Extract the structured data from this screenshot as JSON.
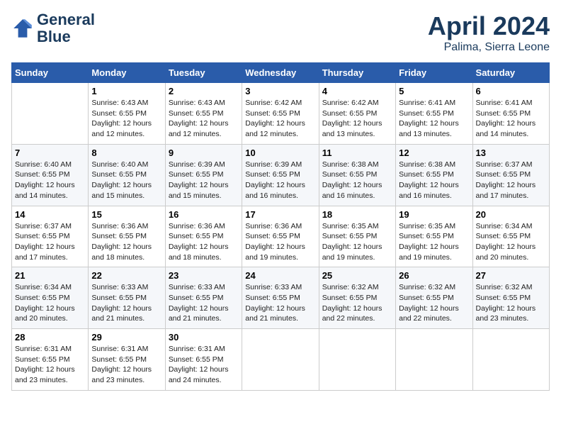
{
  "header": {
    "logo_line1": "General",
    "logo_line2": "Blue",
    "month": "April 2024",
    "location": "Palima, Sierra Leone"
  },
  "columns": [
    "Sunday",
    "Monday",
    "Tuesday",
    "Wednesday",
    "Thursday",
    "Friday",
    "Saturday"
  ],
  "weeks": [
    [
      {
        "day": "",
        "info": ""
      },
      {
        "day": "1",
        "info": "Sunrise: 6:43 AM\nSunset: 6:55 PM\nDaylight: 12 hours\nand 12 minutes."
      },
      {
        "day": "2",
        "info": "Sunrise: 6:43 AM\nSunset: 6:55 PM\nDaylight: 12 hours\nand 12 minutes."
      },
      {
        "day": "3",
        "info": "Sunrise: 6:42 AM\nSunset: 6:55 PM\nDaylight: 12 hours\nand 12 minutes."
      },
      {
        "day": "4",
        "info": "Sunrise: 6:42 AM\nSunset: 6:55 PM\nDaylight: 12 hours\nand 13 minutes."
      },
      {
        "day": "5",
        "info": "Sunrise: 6:41 AM\nSunset: 6:55 PM\nDaylight: 12 hours\nand 13 minutes."
      },
      {
        "day": "6",
        "info": "Sunrise: 6:41 AM\nSunset: 6:55 PM\nDaylight: 12 hours\nand 14 minutes."
      }
    ],
    [
      {
        "day": "7",
        "info": "Sunrise: 6:40 AM\nSunset: 6:55 PM\nDaylight: 12 hours\nand 14 minutes."
      },
      {
        "day": "8",
        "info": "Sunrise: 6:40 AM\nSunset: 6:55 PM\nDaylight: 12 hours\nand 15 minutes."
      },
      {
        "day": "9",
        "info": "Sunrise: 6:39 AM\nSunset: 6:55 PM\nDaylight: 12 hours\nand 15 minutes."
      },
      {
        "day": "10",
        "info": "Sunrise: 6:39 AM\nSunset: 6:55 PM\nDaylight: 12 hours\nand 16 minutes."
      },
      {
        "day": "11",
        "info": "Sunrise: 6:38 AM\nSunset: 6:55 PM\nDaylight: 12 hours\nand 16 minutes."
      },
      {
        "day": "12",
        "info": "Sunrise: 6:38 AM\nSunset: 6:55 PM\nDaylight: 12 hours\nand 16 minutes."
      },
      {
        "day": "13",
        "info": "Sunrise: 6:37 AM\nSunset: 6:55 PM\nDaylight: 12 hours\nand 17 minutes."
      }
    ],
    [
      {
        "day": "14",
        "info": "Sunrise: 6:37 AM\nSunset: 6:55 PM\nDaylight: 12 hours\nand 17 minutes."
      },
      {
        "day": "15",
        "info": "Sunrise: 6:36 AM\nSunset: 6:55 PM\nDaylight: 12 hours\nand 18 minutes."
      },
      {
        "day": "16",
        "info": "Sunrise: 6:36 AM\nSunset: 6:55 PM\nDaylight: 12 hours\nand 18 minutes."
      },
      {
        "day": "17",
        "info": "Sunrise: 6:36 AM\nSunset: 6:55 PM\nDaylight: 12 hours\nand 19 minutes."
      },
      {
        "day": "18",
        "info": "Sunrise: 6:35 AM\nSunset: 6:55 PM\nDaylight: 12 hours\nand 19 minutes."
      },
      {
        "day": "19",
        "info": "Sunrise: 6:35 AM\nSunset: 6:55 PM\nDaylight: 12 hours\nand 19 minutes."
      },
      {
        "day": "20",
        "info": "Sunrise: 6:34 AM\nSunset: 6:55 PM\nDaylight: 12 hours\nand 20 minutes."
      }
    ],
    [
      {
        "day": "21",
        "info": "Sunrise: 6:34 AM\nSunset: 6:55 PM\nDaylight: 12 hours\nand 20 minutes."
      },
      {
        "day": "22",
        "info": "Sunrise: 6:33 AM\nSunset: 6:55 PM\nDaylight: 12 hours\nand 21 minutes."
      },
      {
        "day": "23",
        "info": "Sunrise: 6:33 AM\nSunset: 6:55 PM\nDaylight: 12 hours\nand 21 minutes."
      },
      {
        "day": "24",
        "info": "Sunrise: 6:33 AM\nSunset: 6:55 PM\nDaylight: 12 hours\nand 21 minutes."
      },
      {
        "day": "25",
        "info": "Sunrise: 6:32 AM\nSunset: 6:55 PM\nDaylight: 12 hours\nand 22 minutes."
      },
      {
        "day": "26",
        "info": "Sunrise: 6:32 AM\nSunset: 6:55 PM\nDaylight: 12 hours\nand 22 minutes."
      },
      {
        "day": "27",
        "info": "Sunrise: 6:32 AM\nSunset: 6:55 PM\nDaylight: 12 hours\nand 23 minutes."
      }
    ],
    [
      {
        "day": "28",
        "info": "Sunrise: 6:31 AM\nSunset: 6:55 PM\nDaylight: 12 hours\nand 23 minutes."
      },
      {
        "day": "29",
        "info": "Sunrise: 6:31 AM\nSunset: 6:55 PM\nDaylight: 12 hours\nand 23 minutes."
      },
      {
        "day": "30",
        "info": "Sunrise: 6:31 AM\nSunset: 6:55 PM\nDaylight: 12 hours\nand 24 minutes."
      },
      {
        "day": "",
        "info": ""
      },
      {
        "day": "",
        "info": ""
      },
      {
        "day": "",
        "info": ""
      },
      {
        "day": "",
        "info": ""
      }
    ]
  ]
}
